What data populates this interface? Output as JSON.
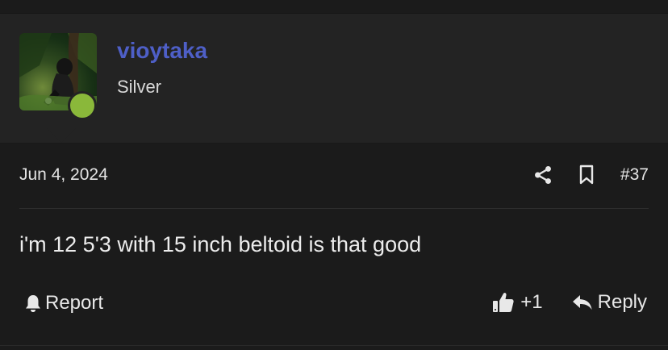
{
  "user": {
    "username": "vioytaka",
    "title": "Silver",
    "status": "online",
    "accent_color": "#4e5fc7",
    "status_color": "#8ab83a"
  },
  "post": {
    "date": "Jun 4, 2024",
    "number": "#37",
    "message": "i'm 12 5'3 with 15 inch beltoid is that good",
    "icons": {
      "share": "share-icon",
      "bookmark": "bookmark-icon"
    }
  },
  "footer": {
    "report_label": "Report",
    "like_count": "+1",
    "reply_label": "Reply",
    "icons": {
      "report": "bell-icon",
      "like": "thumbs-up-icon",
      "reply": "reply-arrow-icon"
    }
  }
}
